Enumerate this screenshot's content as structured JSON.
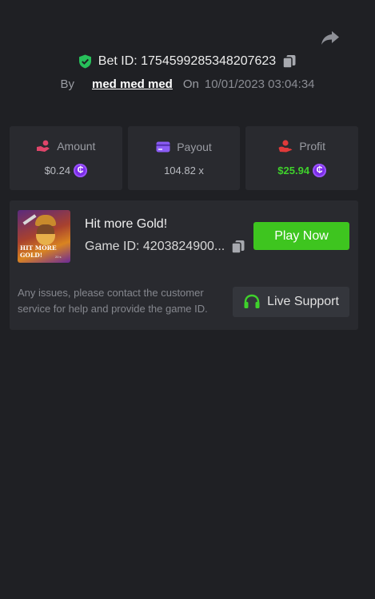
{
  "bet": {
    "id_label": "Bet ID: 1754599285348207623",
    "by_label": "By",
    "username": "med med med",
    "on_label": "On",
    "datetime": "10/01/2023 03:04:34"
  },
  "stats": {
    "amount": {
      "label": "Amount",
      "value": "$0.24",
      "icon": "hand-coins-icon",
      "currency_icon": "coin-icon"
    },
    "payout": {
      "label": "Payout",
      "value": "104.82 x",
      "icon": "card-icon"
    },
    "profit": {
      "label": "Profit",
      "value": "$25.94",
      "icon": "hand-profit-icon",
      "currency_icon": "coin-icon"
    }
  },
  "game": {
    "title": "Hit more Gold!",
    "id_label": "Game ID: 4203824900...",
    "thumb_line1": "HIT MORE",
    "thumb_line2": "GOLD!",
    "thumb_badge": "20 s",
    "play_label": "Play Now"
  },
  "support": {
    "text": "Any issues, please contact the customer service for help and provide the game ID.",
    "button_label": "Live Support",
    "icon": "headset-icon"
  },
  "colors": {
    "background": "#1f2024",
    "card": "#292a2f",
    "accent_green": "#3ec51f",
    "profit_green": "#3fd12c",
    "coin_purple": "#7b2ce8",
    "amount_icon": "#e0456a",
    "payout_icon": "#8b5cf6",
    "profit_icon": "#e03a3a",
    "shield_green": "#27c05a"
  },
  "coin_glyph": "₵"
}
